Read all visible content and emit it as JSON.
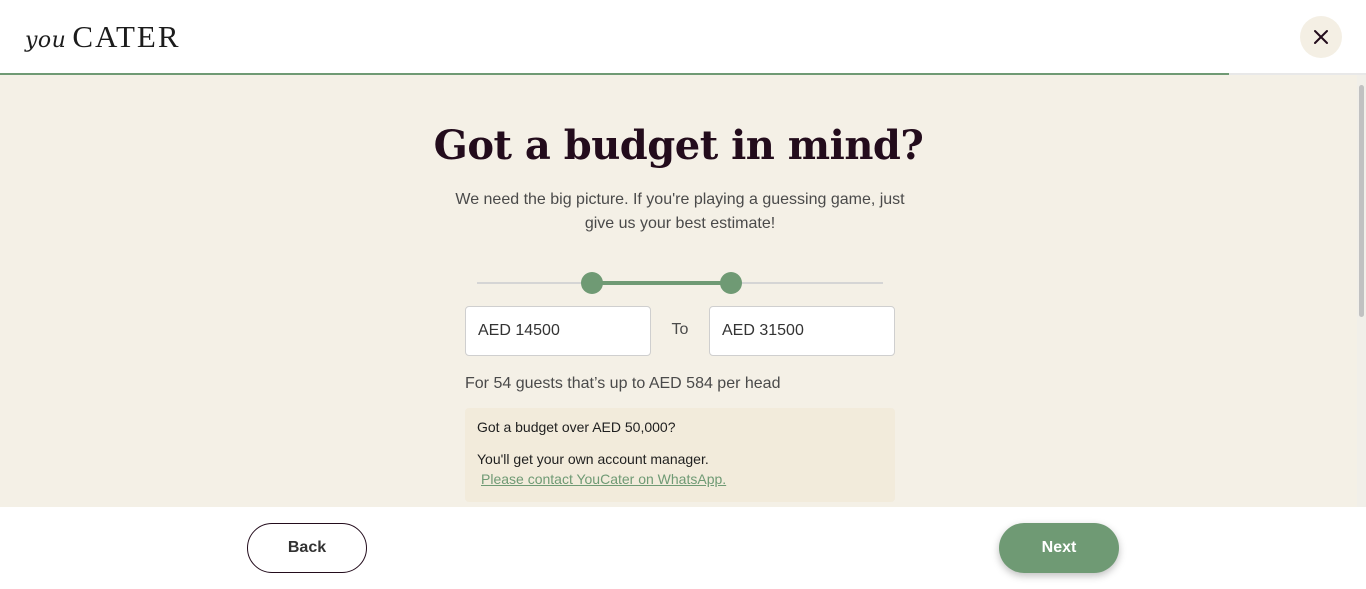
{
  "brand": {
    "logo_script": "you",
    "logo_main": "CATER"
  },
  "header": {
    "close_icon": "close-icon",
    "progress": 0.9
  },
  "main": {
    "title": "Got a budget in mind?",
    "subtitle": "We need the big picture. If you're playing a guessing game, just give us your best estimate!",
    "slider": {
      "min_fraction": 0.283,
      "max_fraction": 0.626
    },
    "min_input": {
      "currency": "AED",
      "value": "14500"
    },
    "to_label": "To",
    "max_input": {
      "currency": "AED",
      "value": "31500"
    },
    "per_head_text": "For 54 guests that’s up to AED 584 per head",
    "info": {
      "heading": "Got a budget over AED 50,000?",
      "body": "You'll get your own account manager.",
      "link": "Please contact YouCater on WhatsApp."
    }
  },
  "footer": {
    "back_label": "Back",
    "next_label": "Next"
  },
  "colors": {
    "accent": "#6f9a74",
    "title": "#230c1c",
    "background": "#f4f0e6",
    "info_bg": "#f2ebdb"
  }
}
